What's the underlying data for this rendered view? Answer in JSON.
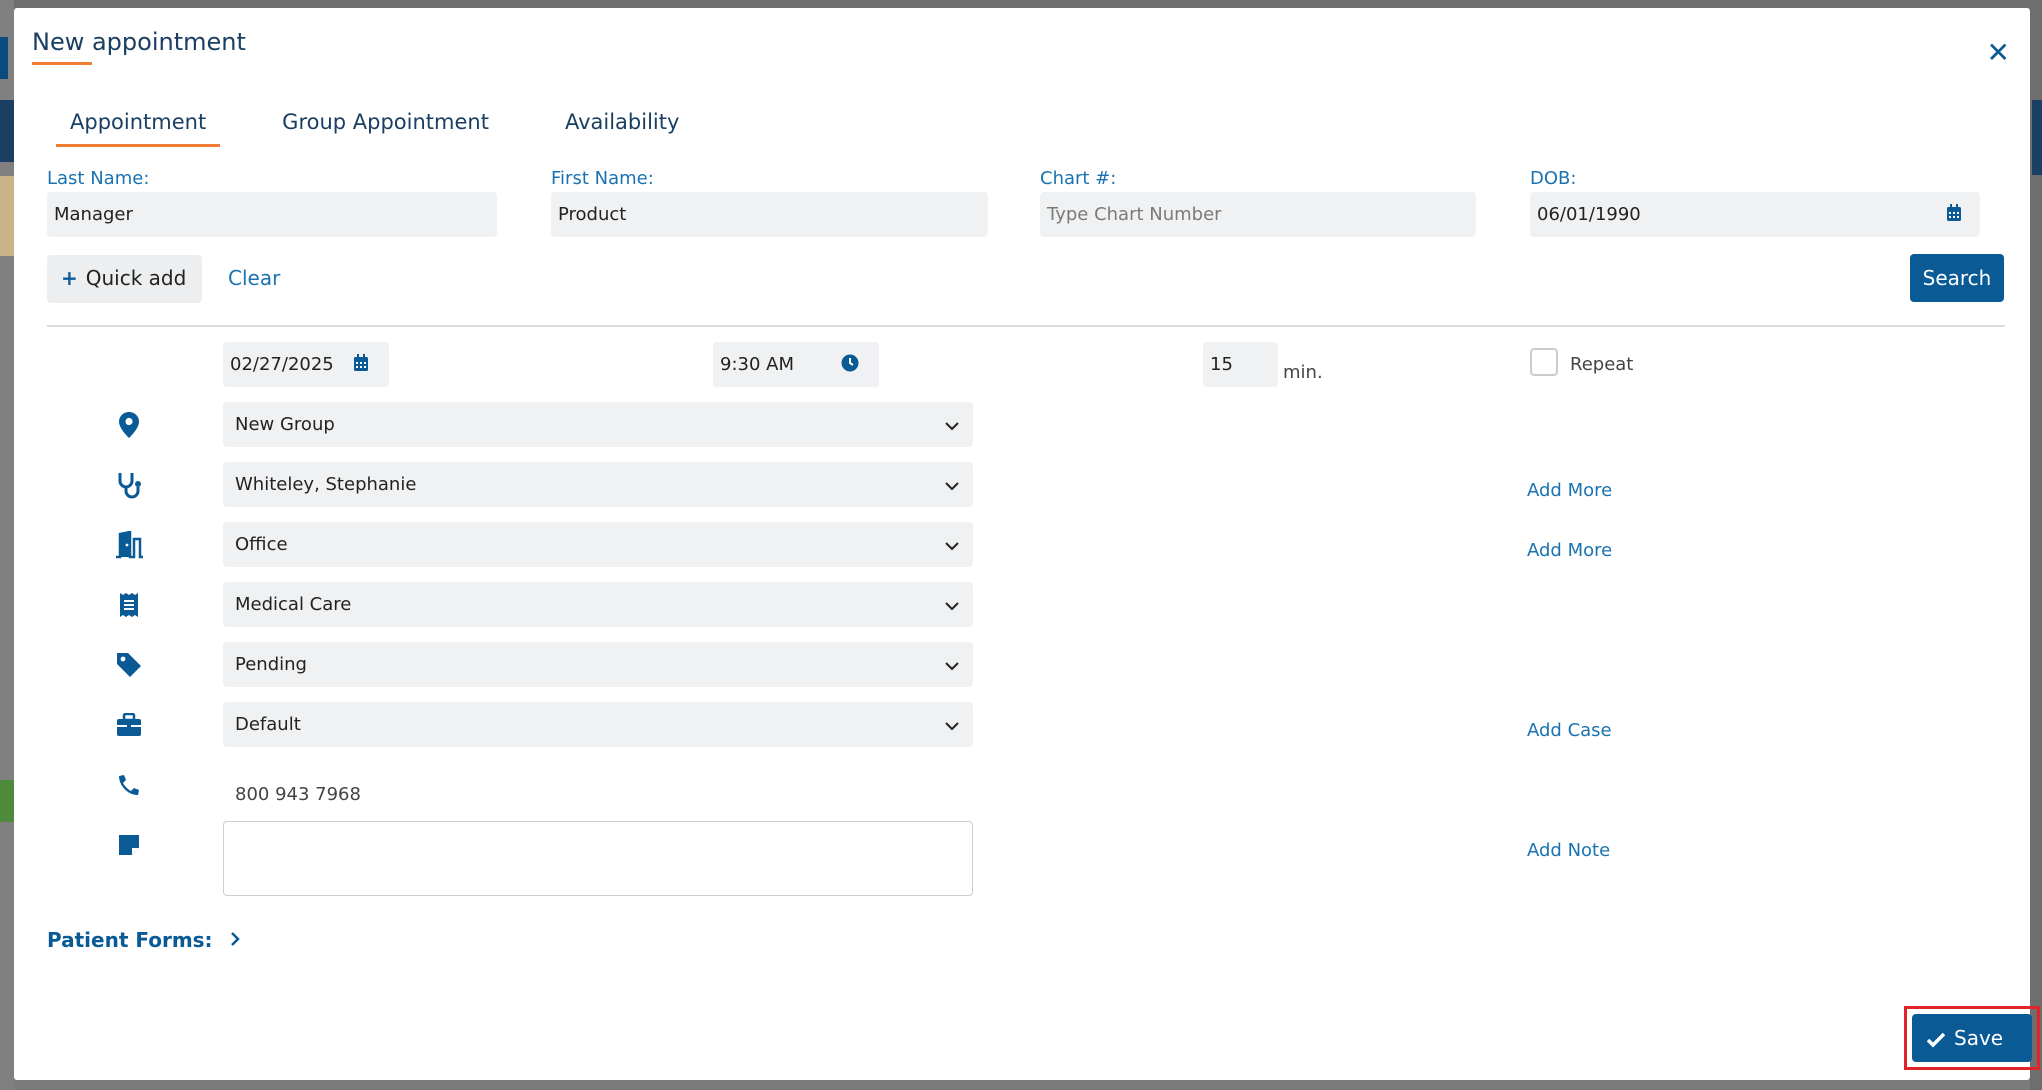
{
  "dialog": {
    "title": "New appointment",
    "close_icon": "close-icon"
  },
  "tabs": [
    {
      "label": "Appointment",
      "active": true
    },
    {
      "label": "Group Appointment",
      "active": false
    },
    {
      "label": "Availability",
      "active": false
    }
  ],
  "patient": {
    "last_name_label": "Last Name:",
    "last_name_value": "Manager",
    "first_name_label": "First Name:",
    "first_name_value": "Product",
    "chart_label": "Chart #:",
    "chart_placeholder": "Type Chart Number",
    "dob_label": "DOB:",
    "dob_value": "06/01/1990"
  },
  "actions": {
    "quick_add_label": "Quick add",
    "clear_label": "Clear",
    "search_label": "Search"
  },
  "schedule": {
    "date": "02/27/2025",
    "time": "9:30 AM",
    "duration": "15",
    "duration_unit": "min.",
    "repeat_label": "Repeat"
  },
  "details": {
    "location": "New Group",
    "provider": "Whiteley, Stephanie",
    "room": "Office",
    "type": "Medical Care",
    "status": "Pending",
    "case": "Default",
    "phone": "800 943 7968"
  },
  "links": {
    "add_more_provider": "Add More",
    "add_more_room": "Add More",
    "add_case": "Add Case",
    "add_note": "Add Note"
  },
  "patient_forms_label": "Patient Forms:",
  "save_label": "Save",
  "colors": {
    "primary": "#0a5a96",
    "accent": "#f07d33",
    "highlight": "#e0242a"
  }
}
